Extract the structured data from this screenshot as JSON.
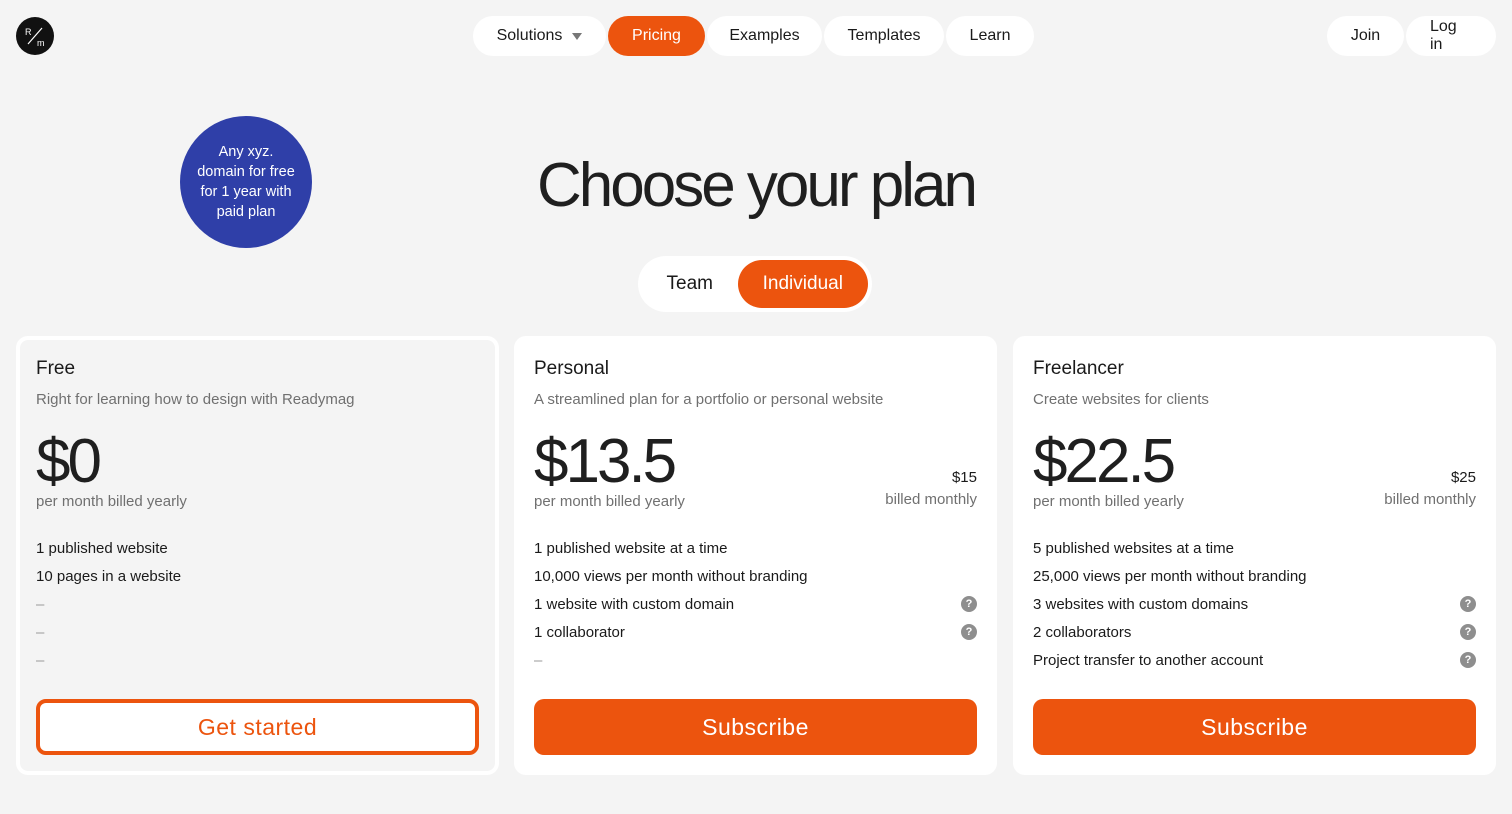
{
  "logo": {
    "top": "R",
    "bottom": "m"
  },
  "nav": {
    "solutions": "Solutions",
    "pricing": "Pricing",
    "examples": "Examples",
    "templates": "Templates",
    "learn": "Learn"
  },
  "auth": {
    "join": "Join",
    "login": "Log in"
  },
  "badge": "Any xyz. domain for free for 1 year with paid plan",
  "title": "Choose your plan",
  "toggle": {
    "team": "Team",
    "individual": "Individual",
    "selected": "Individual"
  },
  "plans": [
    {
      "name": "Free",
      "description": "Right for learning how to design with Readymag",
      "price": "$0",
      "price_note": "per month billed yearly",
      "features": [
        "1 published website",
        "10 pages in a website",
        "–",
        "–",
        "–"
      ],
      "cta": "Get started"
    },
    {
      "name": "Personal",
      "description": "A streamlined plan for a portfolio or personal website",
      "price": "$13.5",
      "price_note": "per month billed yearly",
      "monthly_price": "$15",
      "monthly_label": "billed monthly",
      "features": [
        "1 published website at a time",
        "10,000 views per month without branding",
        "1 website with custom domain",
        "1 collaborator",
        "–"
      ],
      "cta": "Subscribe"
    },
    {
      "name": "Freelancer",
      "description": "Create websites for clients",
      "price": "$22.5",
      "price_note": "per month billed yearly",
      "monthly_price": "$25",
      "monthly_label": "billed monthly",
      "features": [
        "5 published websites at a time",
        "25,000 views per month without branding",
        "3 websites with custom domains",
        "2 collaborators",
        "Project transfer to another account"
      ],
      "cta": "Subscribe"
    }
  ],
  "help_glyph": "?",
  "colors": {
    "accent": "#ec540e",
    "badge": "#2f3fa8",
    "background": "#f4f4f4"
  }
}
